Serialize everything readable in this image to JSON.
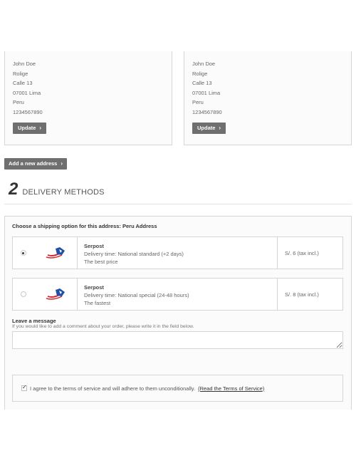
{
  "addresses": [
    {
      "lines": [
        "John Doe",
        "Rolige",
        "Calle 13",
        "07001 Lima",
        "Peru",
        "1234567890"
      ],
      "update_label": "Update"
    },
    {
      "lines": [
        "John Doe",
        "Rolige",
        "Calle 13",
        "07001 Lima",
        "Peru",
        "1234567890"
      ],
      "update_label": "Update"
    }
  ],
  "add_address_label": "Add a new address",
  "delivery": {
    "step_number": "2",
    "step_title": "DELIVERY METHODS",
    "choose_label": "Choose a shipping option for this address: Peru Address",
    "options": [
      {
        "selected": true,
        "carrier": "Serpost",
        "delivery_time": "Delivery time: National standard (+2 days)",
        "note": "The best price",
        "price": "S/. 6 (tax incl.)",
        "logo_icon": "serpost-logo-icon"
      },
      {
        "selected": false,
        "carrier": "Serpost",
        "delivery_time": "Delivery time: National special (24-48 hours)",
        "note": "The fastest",
        "price": "S/. 8 (tax incl.)",
        "logo_icon": "serpost-logo-icon"
      }
    ]
  },
  "message": {
    "label": "Leave a message",
    "hint": "If you would like to add a comment about your order, please write it in the field below.",
    "value": ""
  },
  "terms": {
    "checked": true,
    "text": "I agree to the terms of service and will adhere to them unconditionally.",
    "link_text": "(Read the Terms of Service)"
  },
  "colors": {
    "button_bg": "#6f6f6f",
    "border": "#d6d4d4",
    "panel_bg": "#fbfbfb",
    "logo_blue": "#1f4fa8",
    "logo_red": "#d62630"
  }
}
